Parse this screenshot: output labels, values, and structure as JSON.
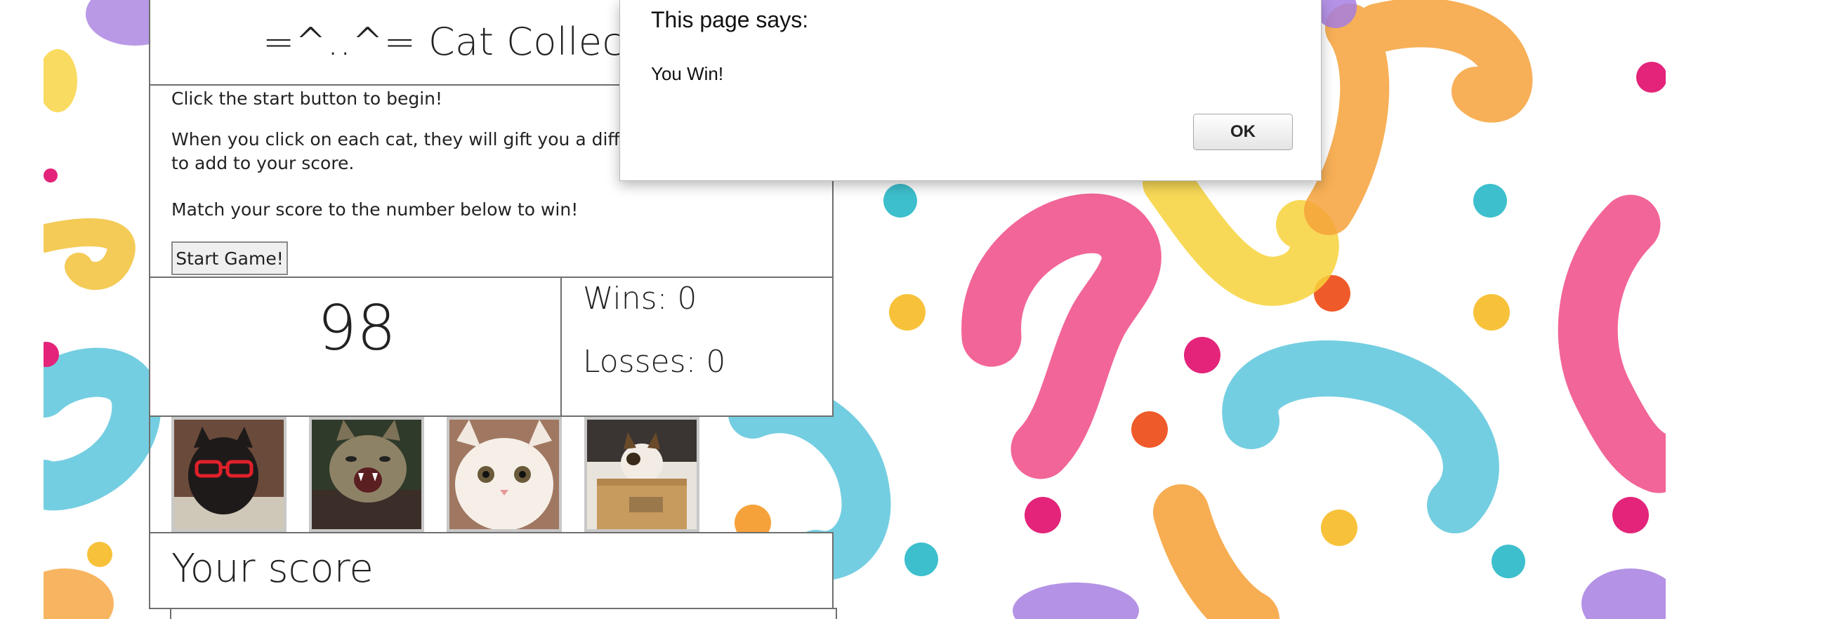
{
  "header": {
    "title": "=^..^= Cat Collector! =^..^="
  },
  "instructions": {
    "line1": "Click the start button to begin!",
    "line2": "When you click on each cat, they will gift you a different amount of points to add to your score.",
    "line3": "Match your score to the number below to win!"
  },
  "start_button": {
    "label": "Start Game!"
  },
  "target_number": "98",
  "stats": {
    "wins": "Wins: 0",
    "losses": "Losses: 0"
  },
  "cats": [
    {
      "name": "black cat with red glasses"
    },
    {
      "name": "tabby cat yawning"
    },
    {
      "name": "white cat close-up"
    },
    {
      "name": "calico cat in cardboard box"
    }
  ],
  "score": {
    "label": "Your score"
  },
  "dialog": {
    "title": "This page says:",
    "message": "You Win!",
    "ok_label": "OK"
  },
  "colors": {
    "pink": "#f0508a",
    "orange": "#f6a23a",
    "blue": "#5cc6dc",
    "yellow": "#f7d23a",
    "purple": "#a77fe0",
    "teal": "#3dbfcd",
    "red": "#ef5a2a",
    "magenta": "#e3247a"
  }
}
